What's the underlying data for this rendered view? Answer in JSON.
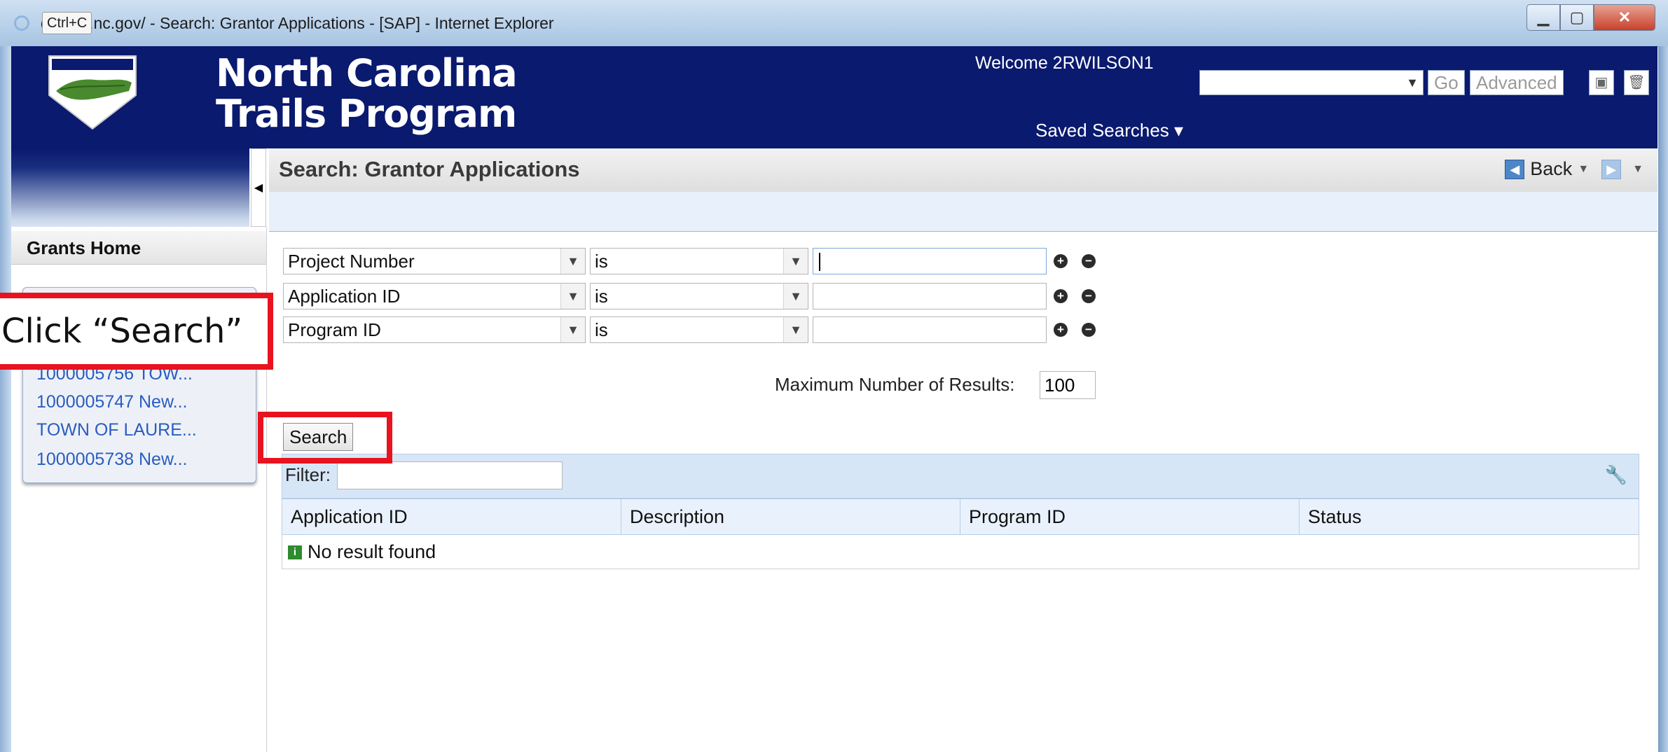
{
  "window": {
    "title": "qa.ebs.nc.gov/ - Search: Grantor Applications - [SAP] - Internet Explorer",
    "ctrl_hint": "Ctrl+C"
  },
  "header": {
    "brand_line1": "North Carolina",
    "brand_line2": "Trails Program",
    "welcome": "Welcome 2RWILSON1",
    "saved_searches_label": "Saved Searches",
    "go_label": "Go",
    "advanced_label": "Advanced"
  },
  "page": {
    "title": "Search: Grantor Applications",
    "back_label": "Back"
  },
  "sidebar": {
    "title": "Grants Home",
    "recent_items": [
      "1000005756 TOW...",
      "1000005747 New...",
      "TOWN OF LAURE...",
      "1000005738 New..."
    ]
  },
  "criteria": [
    {
      "field": "Project Number",
      "operator": "is",
      "value": ""
    },
    {
      "field": "Application ID",
      "operator": "is",
      "value": ""
    },
    {
      "field": "Program ID",
      "operator": "is",
      "value": ""
    }
  ],
  "max_results": {
    "label": "Maximum Number of Results:",
    "value": "100"
  },
  "search_button": "Search",
  "filter_label": "Filter:",
  "results": {
    "columns": [
      "Application ID",
      "Description",
      "Program ID",
      "Status"
    ],
    "empty_message": "No result found"
  },
  "callout": {
    "text": "Click “Search”"
  },
  "colors": {
    "banner": "#0a1a6e",
    "highlight": "#e8131f",
    "link": "#2a5cc0"
  }
}
